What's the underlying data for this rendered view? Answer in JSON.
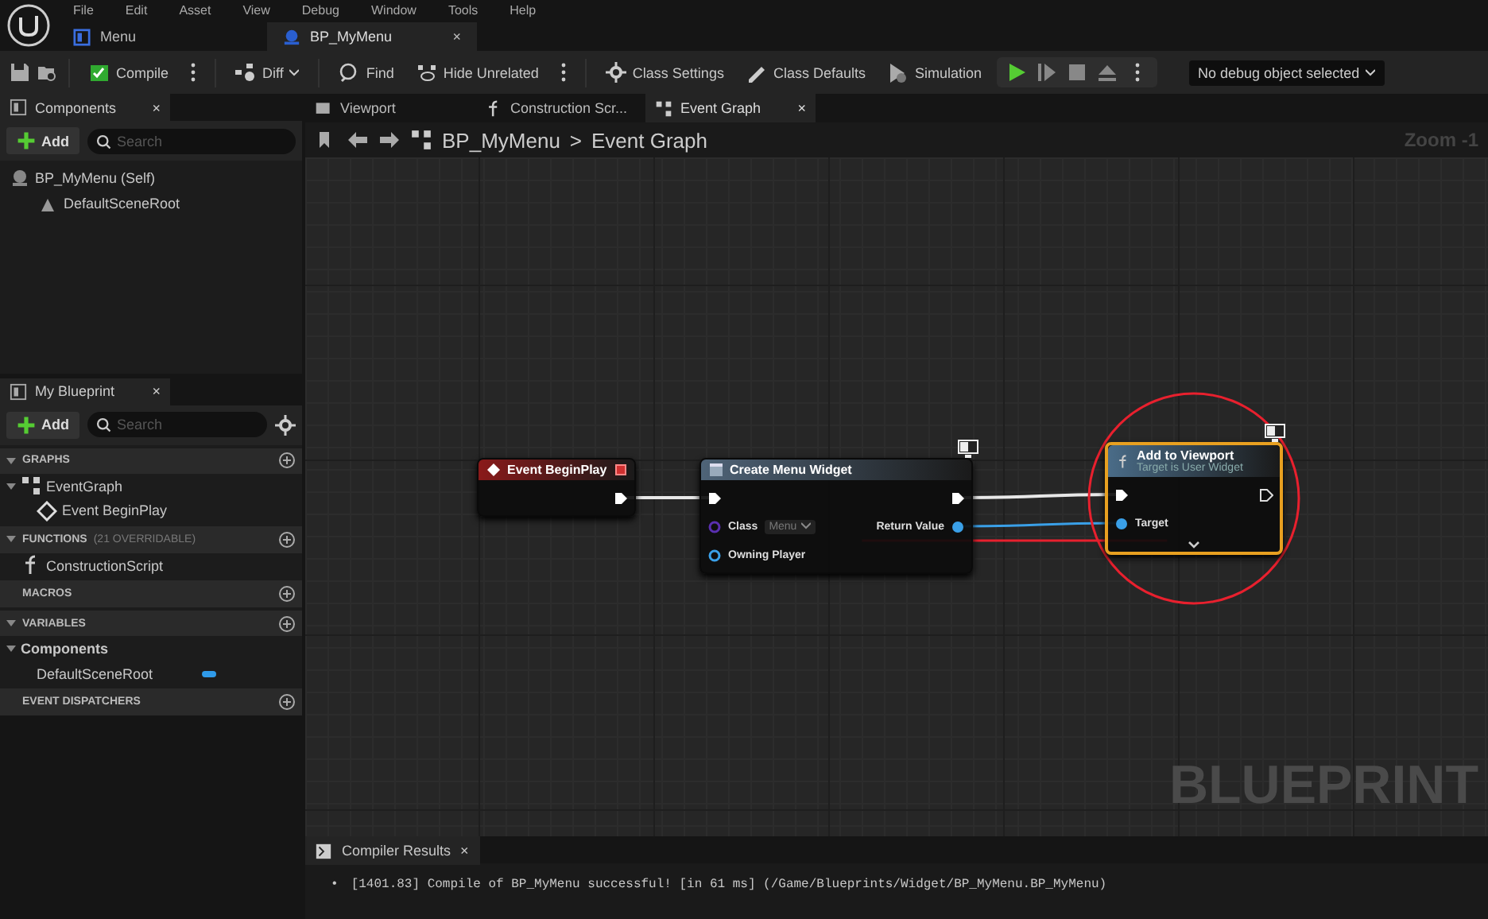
{
  "menu": [
    "File",
    "Edit",
    "Asset",
    "View",
    "Debug",
    "Window",
    "Tools",
    "Help"
  ],
  "document_tabs": [
    {
      "label": "Menu",
      "selected": false
    },
    {
      "label": "BP_MyMenu",
      "selected": true,
      "close": "×"
    }
  ],
  "toolbar": [
    {
      "kind": "icon"
    },
    {
      "kind": "icon"
    },
    {
      "kind": "button",
      "label": "Compile"
    },
    {
      "kind": "more"
    },
    {
      "kind": "dropdown",
      "label": "Diff"
    },
    {
      "kind": "button",
      "label": "Find"
    },
    {
      "kind": "button",
      "label": "Hide Unrelated"
    },
    {
      "kind": "more"
    },
    {
      "kind": "button",
      "label": "Class Settings"
    },
    {
      "kind": "button",
      "label": "Class Defaults"
    },
    {
      "kind": "button",
      "label": "Simulation"
    },
    {
      "kind": "play"
    },
    {
      "kind": "debug",
      "label": "No debug object selected"
    }
  ],
  "components_panel": {
    "title": "Components",
    "close": "×",
    "add": "Add",
    "search_placeholder": "Search",
    "tree": [
      {
        "label": "BP_MyMenu (Self)",
        "children": [
          {
            "label": "DefaultSceneRoot"
          }
        ]
      }
    ]
  },
  "my_blueprint": {
    "title": "My Blueprint",
    "close": "×",
    "add": "Add",
    "search_placeholder": "Search",
    "sections": [
      {
        "title": "GRAPHS",
        "expanded": true,
        "items": [
          {
            "label": "EventGraph",
            "kind": "graph",
            "children": [
              {
                "label": "Event BeginPlay",
                "kind": "event"
              }
            ]
          }
        ]
      },
      {
        "title": "FUNCTIONS",
        "note": "(21 OVERRIDABLE)",
        "expanded": true,
        "items": [
          {
            "label": "ConstructionScript",
            "kind": "function"
          }
        ]
      },
      {
        "title": "MACROS"
      },
      {
        "title": "VARIABLES",
        "expanded": true,
        "items": [
          {
            "label": "Components",
            "kind": "category",
            "children": [
              {
                "label": "DefaultSceneRoot",
                "kind": "variable",
                "color": "#2f9bea"
              }
            ]
          }
        ]
      },
      {
        "title": "EVENT DISPATCHERS"
      }
    ]
  },
  "editor_tabs": [
    {
      "label": "Viewport",
      "selected": false
    },
    {
      "label": "Construction Scr...",
      "selected": false
    },
    {
      "label": "Event Graph",
      "selected": true,
      "close": "×"
    }
  ],
  "breadcrumb": {
    "items": [
      "BP_MyMenu",
      "Event Graph"
    ],
    "separator": ">",
    "zoom": "Zoom -1"
  },
  "graph": {
    "watermark": "BLUEPRINT",
    "nodes": [
      {
        "title": "Event BeginPlay",
        "kind": "event",
        "color": "#8a1a1a",
        "selected": false,
        "rows": [
          {
            "right": {
              "kind": "exec",
              "connected": true
            }
          }
        ]
      },
      {
        "title": "Create Menu Widget",
        "kind": "call",
        "color": "#4f6478",
        "selected": false,
        "rows": [
          {
            "left": {
              "kind": "exec",
              "connected": true
            },
            "right": {
              "kind": "exec",
              "connected": true
            }
          },
          {
            "left": {
              "kind": "data",
              "label": "Class",
              "value": "Menu",
              "connected": false,
              "color": "#5a2fb0"
            },
            "right": {
              "kind": "data",
              "label": "Return Value",
              "connected": true,
              "color": "#3aa0e8"
            }
          },
          {
            "left": {
              "kind": "data",
              "label": "Owning Player",
              "connected": false,
              "color": "#3aa0e8"
            }
          }
        ]
      },
      {
        "title": "Add to Viewport",
        "subtitle": "Target is User Widget",
        "kind": "call",
        "color": "#4a6c88",
        "selected": true,
        "expandable": true,
        "rows": [
          {
            "left": {
              "kind": "exec",
              "connected": true
            },
            "right": {
              "kind": "exec",
              "connected": false
            }
          },
          {
            "left": {
              "kind": "data",
              "label": "Target",
              "connected": true,
              "color": "#3aa0e8"
            }
          }
        ]
      }
    ]
  },
  "compiler_results": {
    "title": "Compiler Results",
    "close": "×",
    "messages": [
      {
        "bullet": "•",
        "text": "[1401.83] Compile of BP_MyMenu successful! [in 61 ms] (/Game/Blueprints/Widget/BP_MyMenu.BP_MyMenu)"
      }
    ]
  }
}
